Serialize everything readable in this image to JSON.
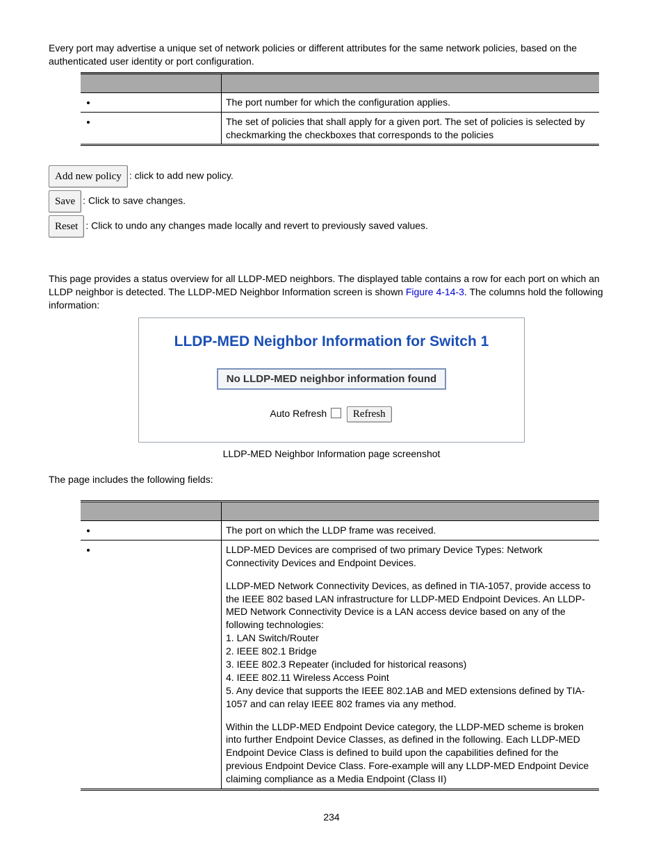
{
  "intro": "Every port may advertise a unique set of network policies or different attributes for the same network policies, based on the authenticated user identity or port configuration.",
  "table1": {
    "row1": {
      "desc": "The port number for which the configuration applies."
    },
    "row2": {
      "desc": "The set of policies that shall apply for a given port. The set of policies is selected by checkmarking the checkboxes that corresponds to the policies"
    }
  },
  "btns": {
    "add": "Add new policy",
    "add_desc": ": click to add new policy.",
    "save": "Save",
    "save_desc": ": Click to save changes.",
    "reset": "Reset",
    "reset_desc": ": Click to undo any changes made locally and revert to previously saved values."
  },
  "overview_before": "This page provides a status overview for all LLDP-MED neighbors. The displayed table contains a row for each port on which an LLDP neighbor is detected. The LLDP-MED Neighbor Information screen is shown ",
  "overview_ref": "Figure 4-14-3",
  "overview_after": ". The columns hold the following information:",
  "fig": {
    "title": "LLDP-MED Neighbor Information for Switch 1",
    "msg": "No LLDP-MED neighbor information found",
    "auto": "Auto Refresh",
    "refresh": "Refresh"
  },
  "caption": "LLDP-MED Neighbor Information page screenshot",
  "lead": "The page includes the following fields:",
  "table2": {
    "row1": {
      "desc": "The port on which the LLDP frame was received."
    },
    "row2": {
      "p1": "LLDP-MED Devices are comprised of two primary Device Types: Network Connectivity Devices and Endpoint Devices.",
      "p2": "LLDP-MED Network Connectivity Devices, as defined in TIA-1057, provide access to the IEEE 802 based LAN infrastructure for LLDP-MED Endpoint Devices. An LLDP-MED Network Connectivity Device is a LAN access device based on any of the following technologies:",
      "l1": "1. LAN Switch/Router",
      "l2": "2. IEEE 802.1 Bridge",
      "l3": "3. IEEE 802.3 Repeater (included for historical reasons)",
      "l4": "4. IEEE 802.11 Wireless Access Point",
      "l5": "5. Any device that supports the IEEE 802.1AB and MED extensions defined by TIA-1057 and can relay IEEE 802 frames via any method.",
      "p3": "Within the LLDP-MED Endpoint Device category, the LLDP-MED scheme is broken into further Endpoint Device Classes, as defined in the following. Each LLDP-MED Endpoint Device Class is defined to build upon the capabilities defined for the previous Endpoint Device Class. Fore-example will any LLDP-MED Endpoint Device claiming compliance as a Media Endpoint (Class II)"
    }
  },
  "pagenum": "234"
}
